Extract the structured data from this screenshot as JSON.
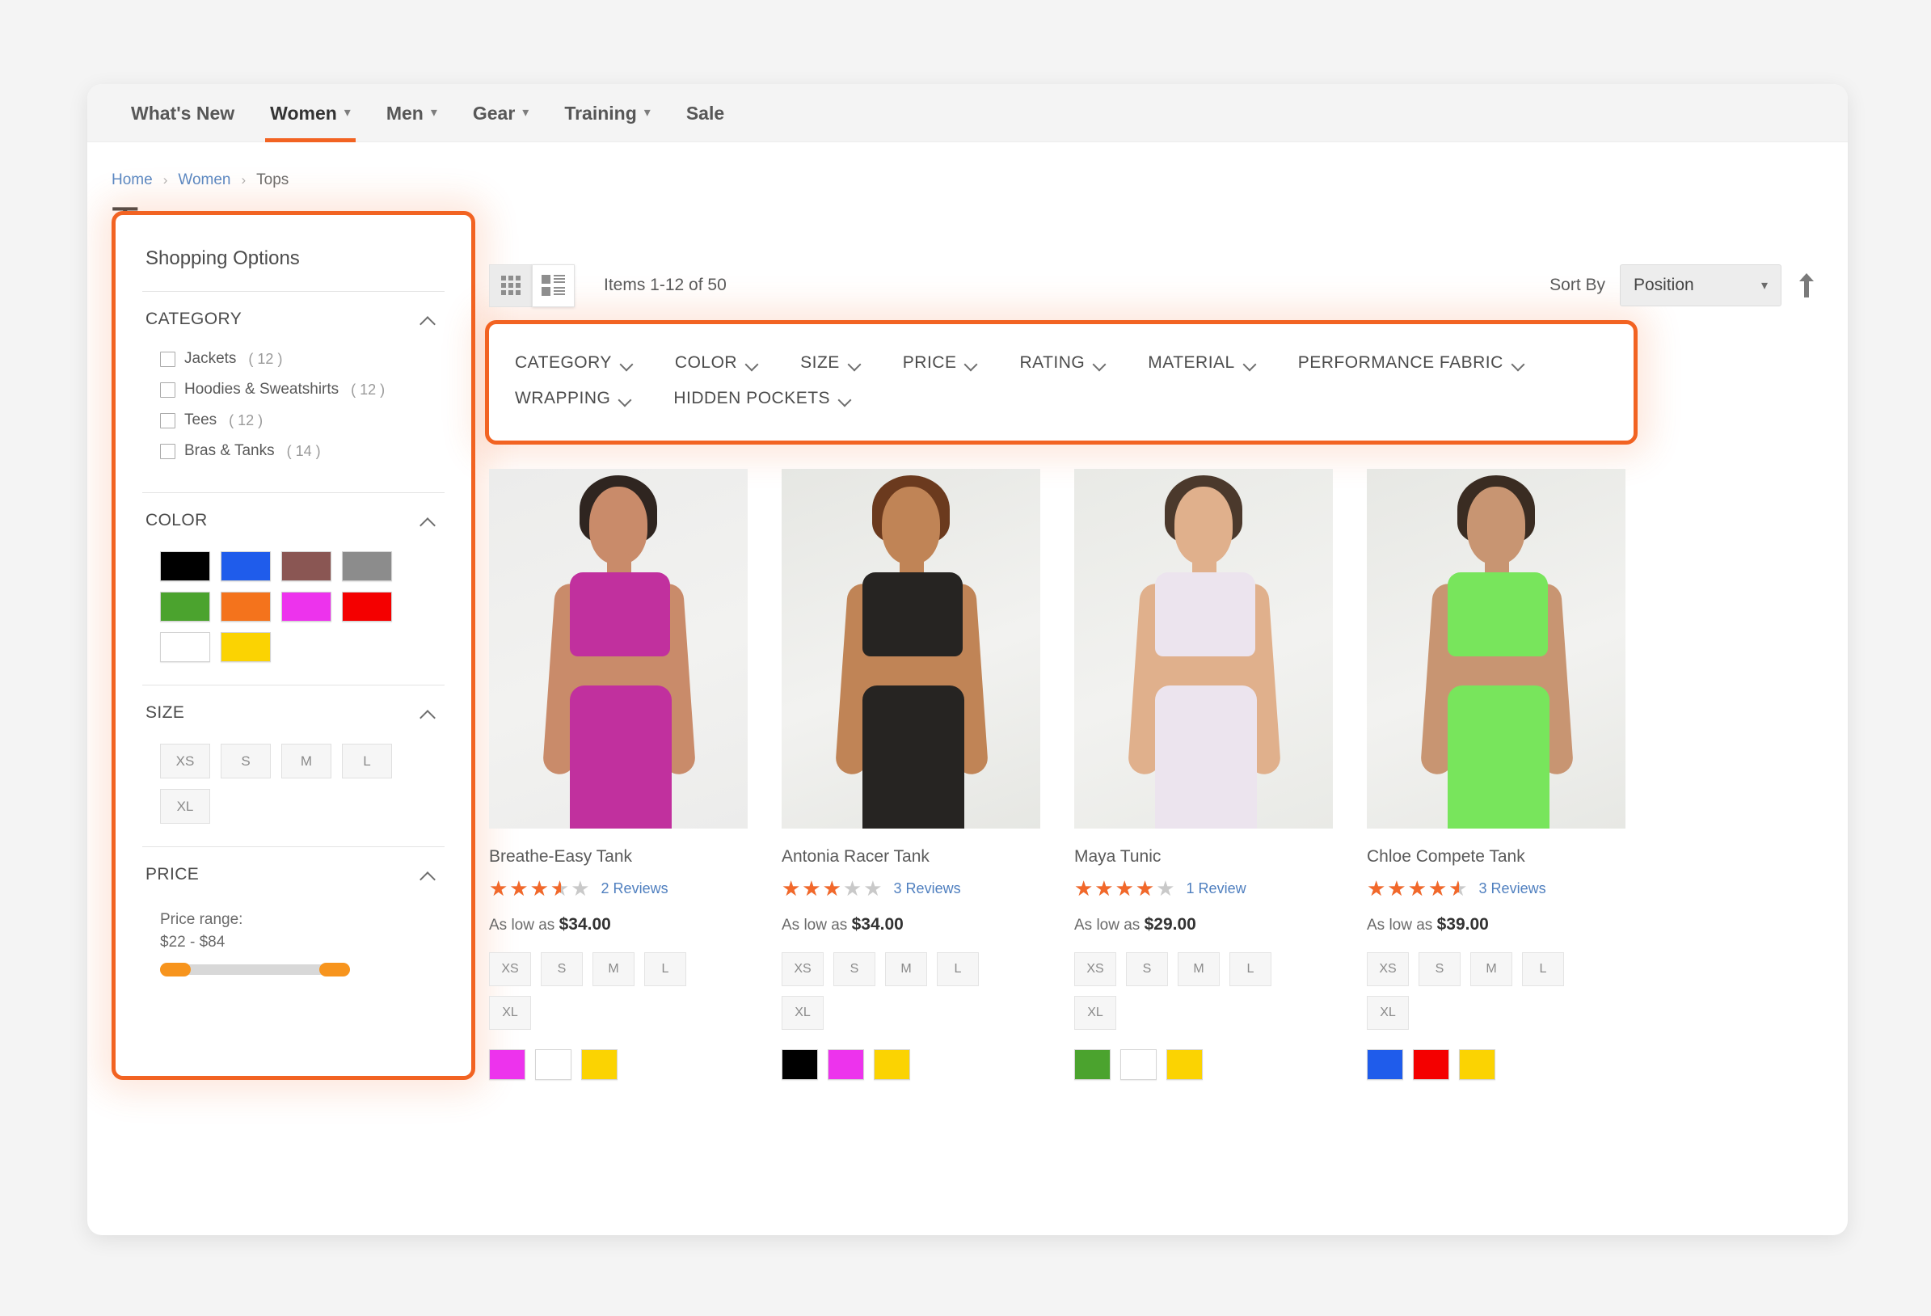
{
  "nav": {
    "items": [
      {
        "label": "What's New",
        "has_caret": false,
        "active": false
      },
      {
        "label": "Women",
        "has_caret": true,
        "active": true
      },
      {
        "label": "Men",
        "has_caret": true,
        "active": false
      },
      {
        "label": "Gear",
        "has_caret": true,
        "active": false
      },
      {
        "label": "Training",
        "has_caret": true,
        "active": false
      },
      {
        "label": "Sale",
        "has_caret": false,
        "active": false
      }
    ]
  },
  "breadcrumb": {
    "home": "Home",
    "sep": "›",
    "women": "Women",
    "current": "Tops"
  },
  "page_title": "Tops",
  "sidebar": {
    "title": "Shopping Options",
    "category": {
      "heading": "CATEGORY",
      "items": [
        {
          "label": "Jackets",
          "count": "( 12 )"
        },
        {
          "label": "Hoodies & Sweatshirts",
          "count": "( 12 )"
        },
        {
          "label": "Tees",
          "count": "( 12 )"
        },
        {
          "label": "Bras & Tanks",
          "count": "( 14 )"
        }
      ]
    },
    "color": {
      "heading": "COLOR",
      "swatches": [
        {
          "name": "black",
          "hex": "#000000"
        },
        {
          "name": "blue",
          "hex": "#1f5ceb"
        },
        {
          "name": "brown",
          "hex": "#8a5653"
        },
        {
          "name": "gray",
          "hex": "#8c8c8c"
        },
        {
          "name": "green",
          "hex": "#4ba32e"
        },
        {
          "name": "orange",
          "hex": "#f4731c"
        },
        {
          "name": "purple",
          "hex": "#ed33ed"
        },
        {
          "name": "red",
          "hex": "#f40000"
        },
        {
          "name": "white",
          "hex": "#ffffff"
        },
        {
          "name": "yellow",
          "hex": "#fbd302"
        }
      ]
    },
    "size": {
      "heading": "SIZE",
      "options": [
        "XS",
        "S",
        "M",
        "L",
        "XL"
      ]
    },
    "price": {
      "heading": "PRICE",
      "range_label": "Price range:",
      "range_value": "$22 - $84",
      "min": "$22",
      "max": "$84"
    }
  },
  "toolbar": {
    "grid_icon": "grid-view-icon",
    "list_icon": "list-view-icon",
    "items_count": "Items 1-12 of 50",
    "sort_label": "Sort By",
    "sort_value": "Position",
    "sort_direction_icon": "sort-ascending-arrow"
  },
  "filter_bar": {
    "items": [
      "CATEGORY",
      "COLOR",
      "SIZE",
      "PRICE",
      "RATING",
      "MATERIAL",
      "PERFORMANCE FABRIC",
      "WRAPPING",
      "HIDDEN POCKETS"
    ]
  },
  "products": [
    {
      "name": "Breathe-Easy Tank",
      "rating_pct": 70,
      "reviews": "2 Reviews",
      "price_prefix": "As low as",
      "price": "$34.00",
      "sizes": [
        "XS",
        "S",
        "M",
        "L",
        "XL"
      ],
      "colors": [
        {
          "name": "purple",
          "hex": "#ed33ed"
        },
        {
          "name": "white",
          "hex": "#ffffff"
        },
        {
          "name": "yellow",
          "hex": "#fbd302"
        }
      ],
      "photo": {
        "garment": "#c1309e",
        "skin": "#c98b6a",
        "hair": "#2f2520",
        "bg": "#ececeb"
      }
    },
    {
      "name": "Antonia Racer Tank",
      "rating_pct": 60,
      "reviews": "3 Reviews",
      "price_prefix": "As low as",
      "price": "$34.00",
      "sizes": [
        "XS",
        "S",
        "M",
        "L",
        "XL"
      ],
      "colors": [
        {
          "name": "black",
          "hex": "#000000"
        },
        {
          "name": "purple",
          "hex": "#ed33ed"
        },
        {
          "name": "yellow",
          "hex": "#fbd302"
        }
      ],
      "photo": {
        "garment": "#262422",
        "skin": "#c08456",
        "hair": "#6b3a1e",
        "bg": "#e6e7e3"
      }
    },
    {
      "name": "Maya Tunic",
      "rating_pct": 80,
      "reviews": "1 Review",
      "price_prefix": "As low as",
      "price": "$29.00",
      "sizes": [
        "XS",
        "S",
        "M",
        "L",
        "XL"
      ],
      "colors": [
        {
          "name": "green",
          "hex": "#4ba32e"
        },
        {
          "name": "white",
          "hex": "#ffffff"
        },
        {
          "name": "yellow",
          "hex": "#fbd302"
        }
      ],
      "photo": {
        "garment": "#ece4ee",
        "skin": "#e0b08c",
        "hair": "#4b392c",
        "bg": "#e9eae6"
      }
    },
    {
      "name": "Chloe Compete Tank",
      "rating_pct": 90,
      "reviews": "3 Reviews",
      "price_prefix": "As low as",
      "price": "$39.00",
      "sizes": [
        "XS",
        "S",
        "M",
        "L",
        "XL"
      ],
      "colors": [
        {
          "name": "blue",
          "hex": "#1f5ceb"
        },
        {
          "name": "red",
          "hex": "#f40000"
        },
        {
          "name": "yellow",
          "hex": "#fbd302"
        }
      ],
      "photo": {
        "garment": "#78e55c",
        "skin": "#c89572",
        "hair": "#3a2c22",
        "bg": "#e7e8e4"
      }
    }
  ],
  "colors": {
    "accent_orange": "#f26322",
    "highlight_border": "#f26322",
    "link_blue": "#4f7fbf",
    "star_orange": "#f2682a"
  }
}
